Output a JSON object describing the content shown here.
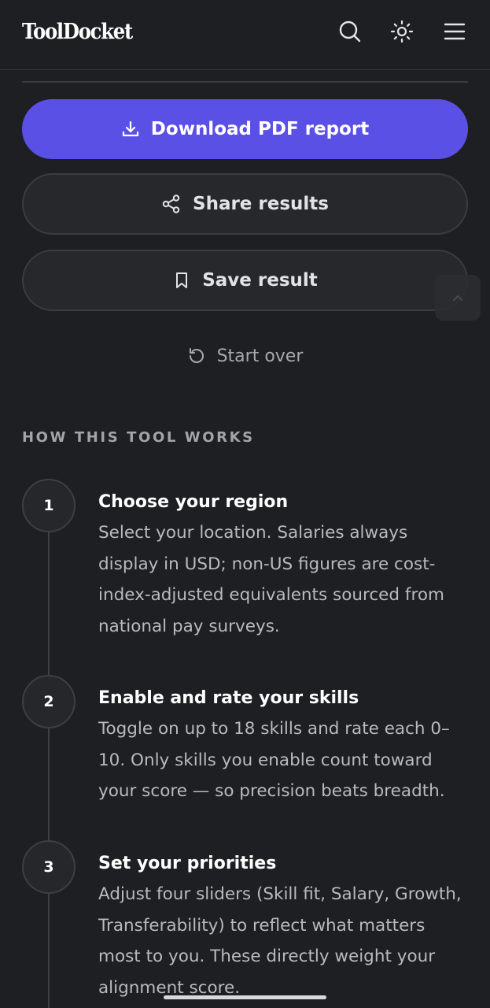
{
  "header": {
    "logo": "ToolDocket",
    "icons": [
      "search-icon",
      "sun-icon",
      "menu-icon"
    ]
  },
  "actions": {
    "download_label": "Download PDF report",
    "share_label": "Share results",
    "save_label": "Save result",
    "start_over_label": "Start over"
  },
  "how_it_works": {
    "title": "HOW THIS TOOL WORKS",
    "steps": [
      {
        "number": "1",
        "title": "Choose your region",
        "description": "Select your location. Salaries always display in USD; non-US figures are cost-index-adjusted equivalents sourced from national pay surveys."
      },
      {
        "number": "2",
        "title": "Enable and rate your skills",
        "description": "Toggle on up to 18 skills and rate each 0–10. Only skills you enable count toward your score — so precision beats breadth."
      },
      {
        "number": "3",
        "title": "Set your priorities",
        "description": "Adjust four sliders (Skill fit, Salary, Growth, Transferability) to reflect what matters most to you. These directly weight your alignment score."
      }
    ]
  },
  "colors": {
    "background": "#1e1f22",
    "primary": "#5b50e6",
    "secondary_button": "#26282c",
    "muted_text": "#b9bac0"
  }
}
